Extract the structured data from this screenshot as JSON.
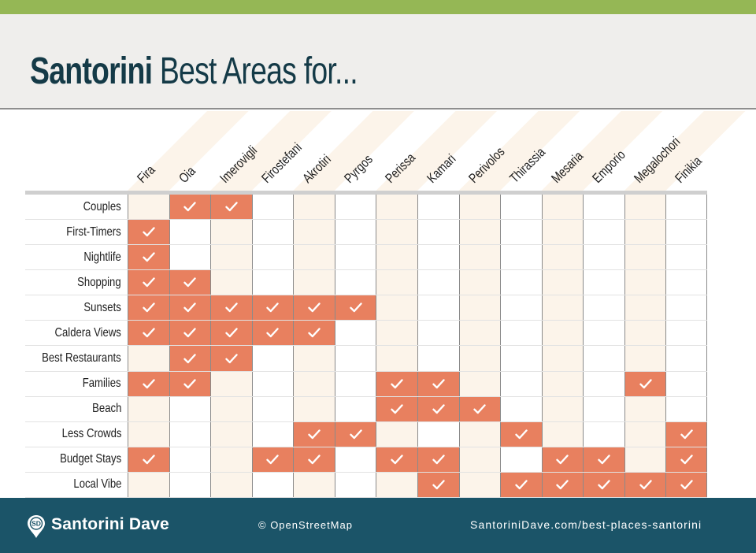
{
  "title": {
    "bold": "Santorini",
    "light": "Best Areas for..."
  },
  "colors": {
    "top_bar": "#95b755",
    "title_bg": "#efeeec",
    "title_text": "#143a47",
    "check_cell": "#e8805f",
    "cream_column": "#fcf4ea",
    "footer_bg": "#1b5468"
  },
  "areas": [
    "Fira",
    "Oia",
    "Imerovigli",
    "Firostefani",
    "Akrotiri",
    "Pyrgos",
    "Perissa",
    "Kamari",
    "Perivolos",
    "Thirassia",
    "Mesaria",
    "Emporio",
    "Megalochori",
    "Finikia"
  ],
  "categories": [
    {
      "label": "Couples",
      "checks": [
        0,
        1,
        1,
        0,
        0,
        0,
        0,
        0,
        0,
        0,
        0,
        0,
        0,
        0
      ]
    },
    {
      "label": "First-Timers",
      "checks": [
        1,
        0,
        0,
        0,
        0,
        0,
        0,
        0,
        0,
        0,
        0,
        0,
        0,
        0
      ]
    },
    {
      "label": "Nightlife",
      "checks": [
        1,
        0,
        0,
        0,
        0,
        0,
        0,
        0,
        0,
        0,
        0,
        0,
        0,
        0
      ]
    },
    {
      "label": "Shopping",
      "checks": [
        1,
        1,
        0,
        0,
        0,
        0,
        0,
        0,
        0,
        0,
        0,
        0,
        0,
        0
      ]
    },
    {
      "label": "Sunsets",
      "checks": [
        1,
        1,
        1,
        1,
        1,
        1,
        0,
        0,
        0,
        0,
        0,
        0,
        0,
        0
      ]
    },
    {
      "label": "Caldera Views",
      "checks": [
        1,
        1,
        1,
        1,
        1,
        0,
        0,
        0,
        0,
        0,
        0,
        0,
        0,
        0
      ]
    },
    {
      "label": "Best Restaurants",
      "checks": [
        0,
        1,
        1,
        0,
        0,
        0,
        0,
        0,
        0,
        0,
        0,
        0,
        0,
        0
      ]
    },
    {
      "label": "Families",
      "checks": [
        1,
        1,
        0,
        0,
        0,
        0,
        1,
        1,
        0,
        0,
        0,
        0,
        1,
        0
      ]
    },
    {
      "label": "Beach",
      "checks": [
        0,
        0,
        0,
        0,
        0,
        0,
        1,
        1,
        1,
        0,
        0,
        0,
        0,
        0
      ]
    },
    {
      "label": "Less Crowds",
      "checks": [
        0,
        0,
        0,
        0,
        1,
        1,
        0,
        0,
        0,
        1,
        0,
        0,
        0,
        1
      ]
    },
    {
      "label": "Budget Stays",
      "checks": [
        1,
        0,
        0,
        1,
        1,
        0,
        1,
        1,
        0,
        0,
        1,
        1,
        0,
        1
      ]
    },
    {
      "label": "Local Vibe",
      "checks": [
        0,
        0,
        0,
        0,
        0,
        0,
        0,
        1,
        0,
        1,
        1,
        1,
        1,
        1
      ]
    }
  ],
  "check_icon": "checkmark-icon",
  "footer": {
    "brand": "Santorini Dave",
    "logo_initials": "SD",
    "logo_icon": "map-pin-icon",
    "credit": "© OpenStreetMap",
    "url": "SantoriniDave.com/best-places-santorini"
  }
}
